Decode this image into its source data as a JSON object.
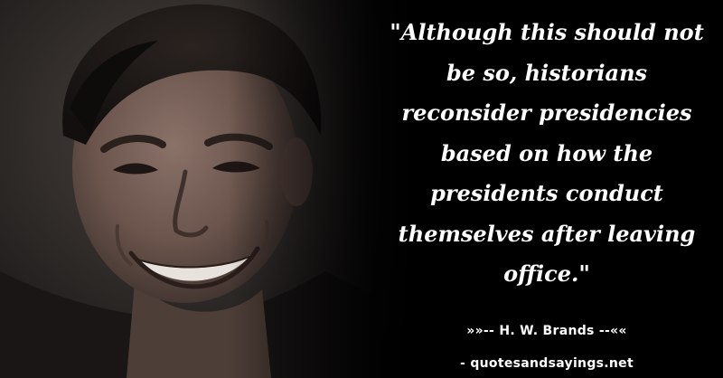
{
  "quote": {
    "lines": [
      "\"Although this should not",
      "be so, historians",
      "reconsider presidencies",
      "based on how the",
      "presidents conduct",
      "themselves after leaving",
      "office.\""
    ]
  },
  "attribution": {
    "author_line": "»»-- H. W. Brands --««",
    "source_line": "- quotesandsayings.net"
  },
  "colors": {
    "background": "#000000",
    "text": "#ffffff"
  }
}
